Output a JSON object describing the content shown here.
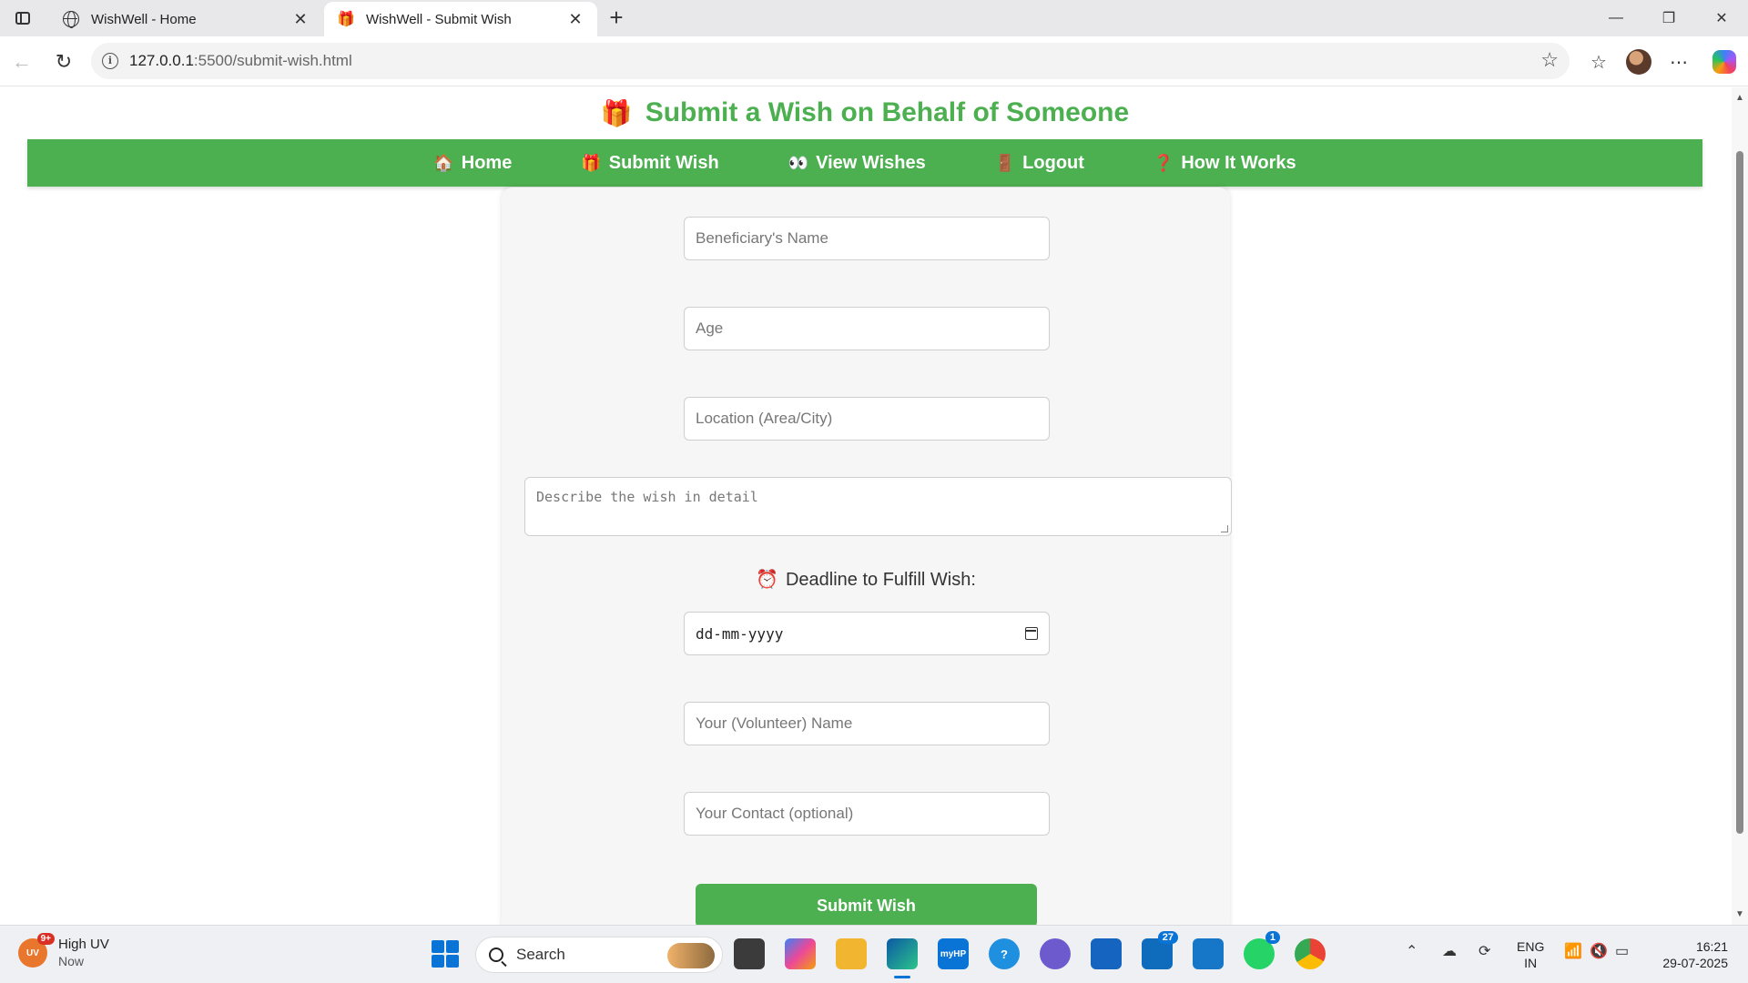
{
  "browser": {
    "tabs": [
      {
        "title": "WishWell - Home",
        "active": false,
        "icon": "globe-icon"
      },
      {
        "title": "WishWell - Submit Wish",
        "active": true,
        "icon": "gift-icon"
      }
    ],
    "new_tab_glyph": "+",
    "url_host": "127.0.0.1",
    "url_path": ":5500/submit-wish.html"
  },
  "page": {
    "title_icon": "🎁",
    "title": "Submit a Wish on Behalf of Someone",
    "accent_color": "#4caf50",
    "nav": [
      {
        "icon": "🏠",
        "label": "Home"
      },
      {
        "icon": "🎁",
        "label": "Submit Wish"
      },
      {
        "icon": "👀",
        "label": "View Wishes"
      },
      {
        "icon": "🚪",
        "label": "Logout"
      },
      {
        "icon": "❓",
        "label": "How It Works"
      }
    ],
    "form": {
      "beneficiary_placeholder": "Beneficiary's Name",
      "age_placeholder": "Age",
      "location_placeholder": "Location (Area/City)",
      "wish_placeholder": "Describe the wish in detail",
      "deadline_icon": "⏰",
      "deadline_label": "Deadline to Fulfill Wish:",
      "date_placeholder": "dd-mm-yyyy",
      "volunteer_placeholder": "Your (Volunteer) Name",
      "contact_placeholder": "Your Contact (optional)",
      "submit_label": "Submit Wish"
    }
  },
  "taskbar": {
    "weather_badge": "9+",
    "weather_icon_text": "UV",
    "weather_title": "High UV",
    "weather_sub": "Now",
    "search_label": "Search",
    "outlook_count": "27",
    "whatsapp_count": "1",
    "lang_top": "ENG",
    "lang_bottom": "IN",
    "time": "16:21",
    "date": "29-07-2025"
  }
}
